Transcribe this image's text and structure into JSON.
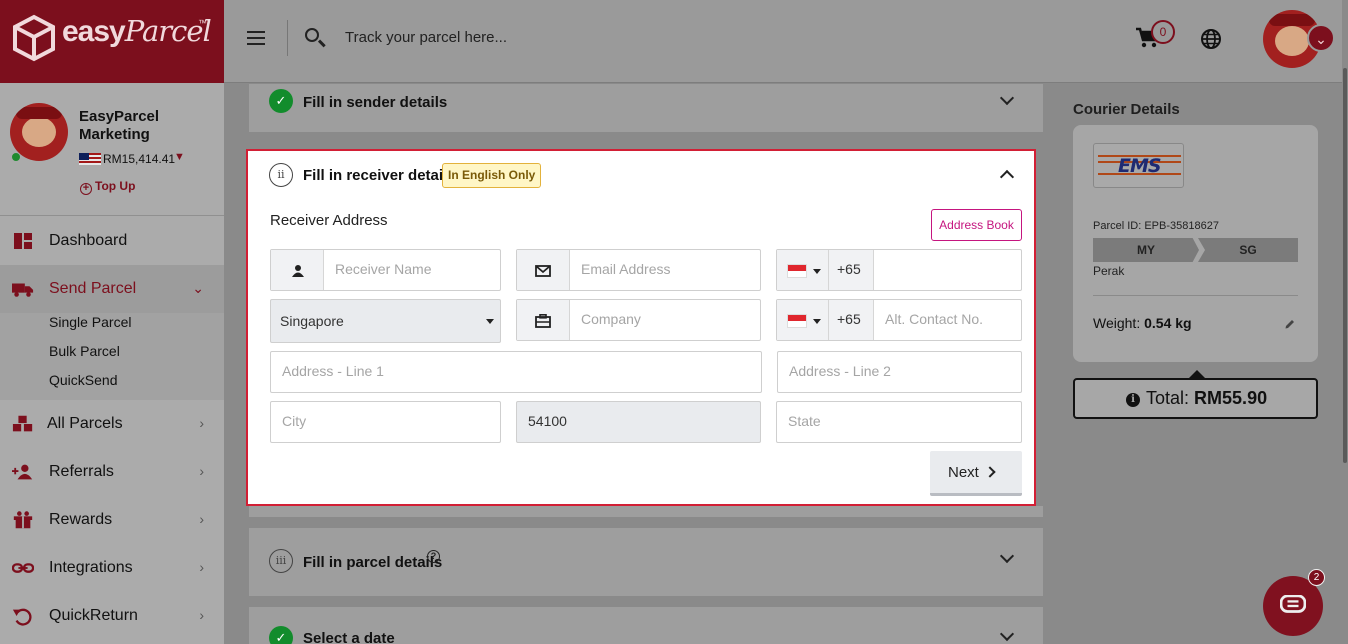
{
  "brand": {
    "logo_main": "easy",
    "logo_script": "Parcel",
    "logo_tm": "™"
  },
  "header": {
    "search_placeholder": "Track your parcel here...",
    "cart_count": "0"
  },
  "profile": {
    "name": "EasyParcel Marketing",
    "balance": "RM15,414.41",
    "topup_label": "Top Up"
  },
  "sidebar": {
    "items": [
      {
        "label": "Dashboard",
        "icon": "dashboard-icon"
      },
      {
        "label": "Send Parcel",
        "icon": "truck-icon",
        "active": true
      },
      {
        "label": "All Parcels",
        "icon": "boxes-icon"
      },
      {
        "label": "Referrals",
        "icon": "referral-icon"
      },
      {
        "label": "Rewards",
        "icon": "gift-icon"
      },
      {
        "label": "Integrations",
        "icon": "link-icon"
      },
      {
        "label": "QuickReturn",
        "icon": "return-icon"
      }
    ],
    "sub_items": [
      "Single Parcel",
      "Bulk Parcel",
      "QuickSend"
    ]
  },
  "steps": {
    "sender": {
      "title": "Fill in sender details"
    },
    "receiver": {
      "numeral": "ii",
      "title": "Fill in receiver details",
      "badge": "In English Only",
      "section_label": "Receiver Address",
      "address_book": "Address Book"
    },
    "parcel": {
      "numeral": "iii",
      "title": "Fill in parcel details"
    },
    "date": {
      "title": "Select a date"
    }
  },
  "form": {
    "receiver_name_ph": "Receiver Name",
    "email_ph": "Email Address",
    "phone_code": "+65",
    "country_value": "Singapore",
    "company_ph": "Company",
    "alt_phone_code": "+65",
    "alt_contact_ph": "Alt. Contact No.",
    "address1_ph": "Address - Line 1",
    "address2_ph": "Address - Line 2",
    "city_ph": "City",
    "postcode_value": "54100",
    "state_ph": "State",
    "next_label": "Next"
  },
  "courier": {
    "title": "Courier Details",
    "logo_text": "EMS",
    "parcel_id": "Parcel ID: EPB-35818627",
    "from": "MY",
    "to": "SG",
    "origin_state": "Perak",
    "weight_label": "Weight:",
    "weight_value": "0.54 kg",
    "total_label": "Total:",
    "total_value": "RM55.90"
  },
  "chat": {
    "badge_count": "2"
  },
  "colors": {
    "brand": "#7c0f1d",
    "accent_pink": "#c5157f",
    "success": "#128c2c",
    "highlight_border": "#d21f35"
  }
}
